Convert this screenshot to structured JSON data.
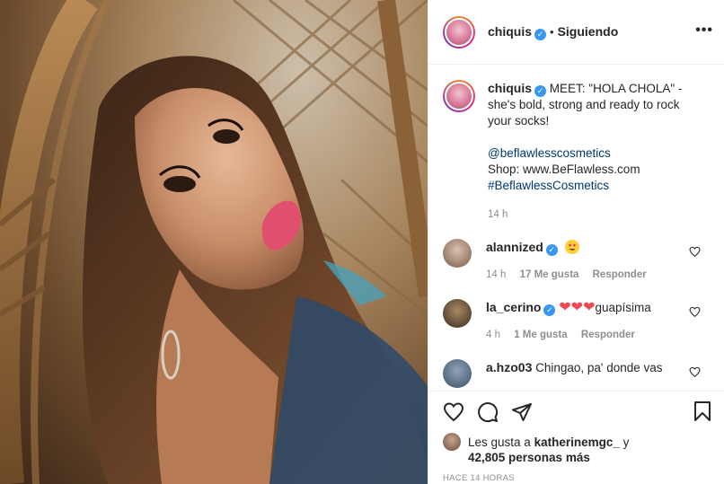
{
  "header": {
    "username": "chiquis",
    "separator": "•",
    "follow_status": "Siguiendo",
    "more": "•••"
  },
  "caption": {
    "username": "chiquis",
    "text": "MEET: \"HOLA CHOLA\" - she's bold, strong and ready to rock your socks!",
    "mention": "@beflawlesscosmetics",
    "shop_line": "Shop: www.BeFlawless.com",
    "hashtag": "#BeflawlessCosmetics",
    "time": "14 h"
  },
  "comments": [
    {
      "username": "alannized",
      "text": "",
      "emoji": "heart-eyes-emoji",
      "time": "14 h",
      "likes": "17 Me gusta",
      "reply": "Responder"
    },
    {
      "username": "la_cerino",
      "hearts": "❤❤❤",
      "text": "guapísima",
      "time": "4 h",
      "likes": "1 Me gusta",
      "reply": "Responder"
    },
    {
      "username": "a.hzo03",
      "text": "Chingao, pa' donde vas"
    }
  ],
  "likes": {
    "prefix": "Les gusta a",
    "user": "katherinemgc_",
    "and": "y",
    "count": "42,805 personas más"
  },
  "posted_ago": "HACE 14 HORAS",
  "colors": {
    "verified": "#3897f0",
    "link": "#00376b",
    "heart": "#ed4956",
    "muted": "#8e8e8e"
  }
}
